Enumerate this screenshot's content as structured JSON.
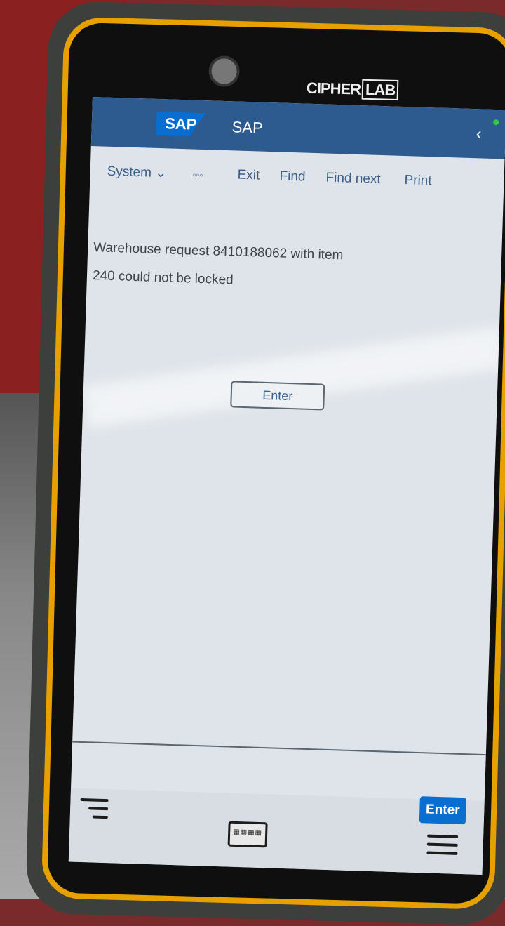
{
  "device": {
    "brand_main": "CIPHER",
    "brand_box": "LAB"
  },
  "shellbar": {
    "logo_text": "SAP",
    "title": "SAP",
    "back_icon": "chevron-left-icon",
    "status_color": "#2ecc40",
    "background_color": "#2d5a8f"
  },
  "toolbar": {
    "system_label": "System",
    "system_icon": "chevron-down-icon",
    "more_label": "◦◦◦",
    "exit_label": "Exit",
    "find_label": "Find",
    "find_next_label": "Find next",
    "print_label": "Print"
  },
  "message": {
    "line1": "Warehouse request 8410188062 with item",
    "line2": "240 could not be locked"
  },
  "inline_enter_label": "Enter",
  "footer": {
    "enter_label": "Enter",
    "enter_color": "#0a6ed1",
    "menu_icon": "left-aligned-menu-icon",
    "keyboard_icon": "keyboard-icon",
    "hamburger_icon": "hamburger-icon"
  }
}
